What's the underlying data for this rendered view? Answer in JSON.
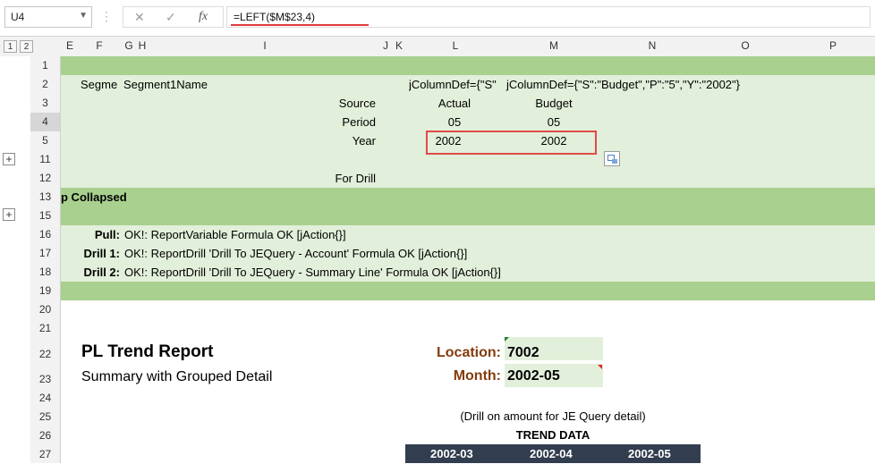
{
  "name_box": {
    "value": "U4"
  },
  "formula_bar": {
    "cancel_icon": "close-icon",
    "enter_icon": "check-icon",
    "fx_label": "fx",
    "formula": "=LEFT($M$23,4)"
  },
  "outline_levels": [
    "1",
    "2"
  ],
  "columns": [
    "E",
    "F",
    "G",
    "H",
    "I",
    "J",
    "K",
    "L",
    "M",
    "N",
    "O",
    "P"
  ],
  "rows": {
    "r1": "1",
    "r2": {
      "num": "2",
      "f": "Segme",
      "h": "Segment1Name",
      "l": "jColumnDef={\"S\"",
      "m": "jColumnDef={\"S\":\"Budget\",\"P\":\"5\",\"Y\":\"2002\"}"
    },
    "r3": {
      "num": "3",
      "label": "Source",
      "l": "Actual",
      "m": "Budget"
    },
    "r4": {
      "num": "4",
      "label": "Period",
      "l": "05",
      "m": "05"
    },
    "r5": {
      "num": "5",
      "label": "Year",
      "l": "2002",
      "m": "2002"
    },
    "r11": "11",
    "r12": {
      "num": "12",
      "label": "For Drill"
    },
    "r13": {
      "num": "13",
      "text": "p Collapsed"
    },
    "r15": "15",
    "r16": {
      "num": "16",
      "label": "Pull:",
      "text": "OK!: ReportVariable Formula OK [jAction{}]"
    },
    "r17": {
      "num": "17",
      "label": "Drill 1:",
      "text": "OK!: ReportDrill 'Drill To JEQuery - Account' Formula OK [jAction{}]"
    },
    "r18": {
      "num": "18",
      "label": "Drill 2:",
      "text": "OK!: ReportDrill 'Drill To JEQuery - Summary Line' Formula OK [jAction{}]"
    },
    "r19": "19",
    "r20": "20",
    "r21": "21",
    "r22": {
      "num": "22",
      "title": "PL Trend Report",
      "loc_label": "Location:",
      "loc_value": "7002"
    },
    "r23": {
      "num": "23",
      "subtitle": "Summary with Grouped Detail",
      "month_label": "Month:",
      "month_value": "2002-05"
    },
    "r24": "24",
    "r25": {
      "num": "25",
      "note": "(Drill on amount for JE Query detail)"
    },
    "r26": {
      "num": "26",
      "trend_title": "TREND DATA"
    },
    "r27": {
      "num": "27",
      "periods": [
        "2002-03",
        "2002-04",
        "2002-05"
      ]
    }
  },
  "colors": {
    "group_band": "#a9d08e",
    "group_fill": "#e2efda",
    "label_brown": "#843c0c",
    "trend_header": "#323e4f",
    "highlight": "#e04a4a"
  }
}
